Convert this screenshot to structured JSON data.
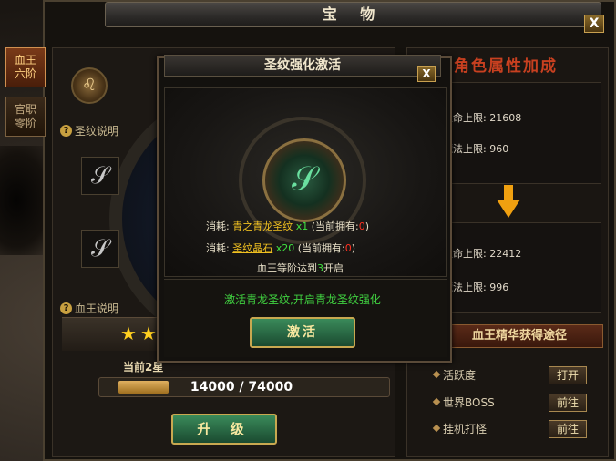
{
  "window": {
    "title": "宝 物",
    "close_label": "X"
  },
  "side_tabs": [
    {
      "label": "血王六阶",
      "line1": "血王",
      "line2": "六阶",
      "active": true
    },
    {
      "label": "官职零阶",
      "line1": "官职",
      "line2": "零阶",
      "active": false
    }
  ],
  "left": {
    "rune_help_label": "圣纹说明",
    "blood_king_help_label": "血王说明",
    "current_stage_label": "当前2星",
    "progress": {
      "current": 14000,
      "max": 74000,
      "text": "14000 / 74000"
    },
    "upgrade_label": "升 级"
  },
  "right": {
    "title": "当前角色属性加成",
    "current_attrs": [
      {
        "label": "生命上限: 21608"
      },
      {
        "label": "魔法上限: 960"
      }
    ],
    "next_attrs": [
      {
        "label": "生命上限: 22412"
      },
      {
        "label": "魔法上限: 996"
      }
    ],
    "sources_header": "血王精华获得途径",
    "sources": [
      {
        "name": "活跃度",
        "button": "打开"
      },
      {
        "name": "世界BOSS",
        "button": "前往"
      },
      {
        "name": "挂机打怪",
        "button": "前往"
      }
    ]
  },
  "modal": {
    "title": "圣纹强化激活",
    "close_label": "X",
    "cost_label": "消耗:",
    "cost1": {
      "item": "青之青龙圣纹",
      "qty": "x1",
      "owned_prefix": "(当前拥有:",
      "owned": "0",
      "owned_suffix": ")"
    },
    "cost2": {
      "item": "圣纹晶石",
      "qty": "x20",
      "owned_prefix": "(当前拥有:",
      "owned": "0",
      "owned_suffix": ")"
    },
    "requirement": {
      "prefix": "血王等阶达到",
      "value": "3",
      "suffix": "开启"
    },
    "description": "激活青龙圣纹,开启青龙圣纹强化",
    "activate_label": "激活"
  },
  "colors": {
    "accent_gold": "#c8a850",
    "button_green": "#3a8a5a",
    "title_red": "#c84020",
    "text_green": "#40d040"
  }
}
